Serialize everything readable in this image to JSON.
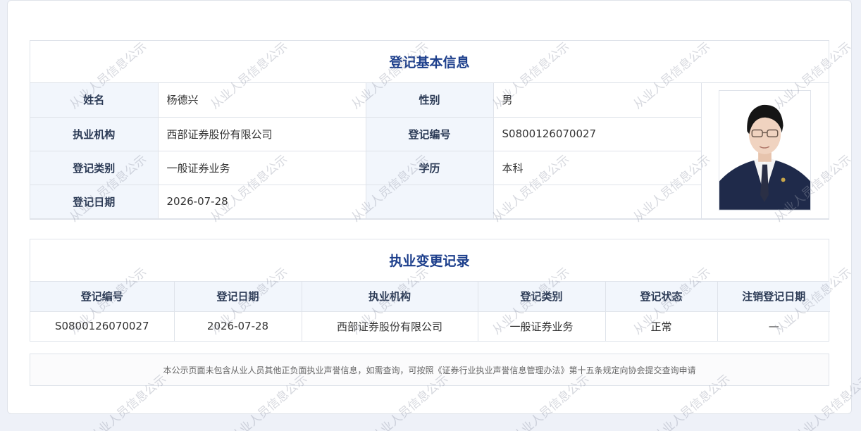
{
  "basic_info": {
    "title": "登记基本信息",
    "rows": [
      {
        "label1": "姓名",
        "value1": "杨德兴",
        "label2": "性别",
        "value2": "男"
      },
      {
        "label1": "执业机构",
        "value1": "西部证券股份有限公司",
        "label2": "登记编号",
        "value2": "S0800126070027"
      },
      {
        "label1": "登记类别",
        "value1": "一般证券业务",
        "label2": "学历",
        "value2": "本科"
      },
      {
        "label1": "登记日期",
        "value1": "2026-07-28",
        "label2": "",
        "value2": ""
      }
    ]
  },
  "change_records": {
    "title": "执业变更记录",
    "headers": [
      "登记编号",
      "登记日期",
      "执业机构",
      "登记类别",
      "登记状态",
      "注销登记日期"
    ],
    "rows": [
      [
        "S0800126070027",
        "2026-07-28",
        "西部证券股份有限公司",
        "一般证券业务",
        "正常",
        "—"
      ]
    ]
  },
  "notice": "本公示页面未包含从业人员其他正负面执业声誉信息，如需查询，可按照《证券行业执业声誉信息管理办法》第十五条规定向协会提交查询申请",
  "watermark": "从业人员信息公示",
  "colors": {
    "title": "#1d3f8c",
    "label_bg": "#f2f6fc",
    "border": "#dfe3ea",
    "page_bg": "#eef1f8"
  },
  "photo_icon": "person-photo"
}
